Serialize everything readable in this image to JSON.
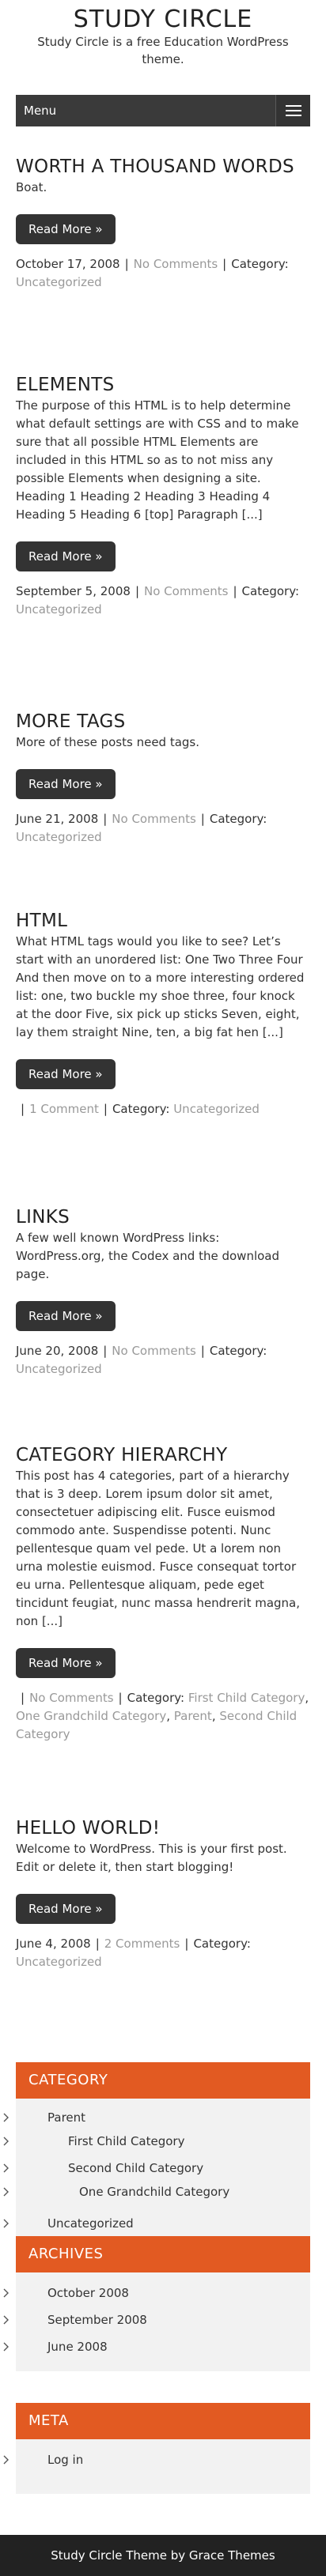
{
  "site": {
    "title": "STUDY CIRCLE",
    "description": "Study Circle is a free Education WordPress theme.",
    "menu_label": "Menu"
  },
  "posts": [
    {
      "title": "WORTH A THOUSAND WORDS",
      "excerpt": "Boat.",
      "read_more": "Read More »",
      "date": "October 17, 2008",
      "comments": "No Comments",
      "category_label": "Category:",
      "categories": [
        "Uncategorized"
      ]
    },
    {
      "title": "ELEMENTS",
      "excerpt": "The purpose of this HTML is to help determine what default settings are with CSS and to make sure that all possible HTML Elements are included in this HTML so as to not miss any possible Elements when designing a site. Heading 1 Heading 2 Heading 3 Heading 4 Heading 5 Heading 6 [top] Paragraph [...]",
      "read_more": "Read More »",
      "date": "September 5, 2008",
      "comments": "No Comments",
      "category_label": "Category:",
      "categories": [
        "Uncategorized"
      ]
    },
    {
      "title": "MORE TAGS",
      "excerpt": "More of these posts need tags.",
      "read_more": "Read More »",
      "date": "June 21, 2008",
      "comments": "No Comments",
      "category_label": "Category:",
      "categories": [
        "Uncategorized"
      ]
    },
    {
      "title": "HTML",
      "excerpt": "What HTML tags would you like to see? Let’s start with an unordered list: One Two Three Four And then move on to a more interesting ordered list: one, two buckle my shoe three, four knock at the door Five, six pick up sticks Seven, eight, lay them straight Nine, ten, a big fat hen [...]",
      "read_more": "Read More »",
      "date": "",
      "comments": "1 Comment",
      "category_label": "Category:",
      "categories": [
        "Uncategorized"
      ]
    },
    {
      "title": "LINKS",
      "excerpt": "A few well known WordPress links: WordPress.org, the Codex and the download page.",
      "read_more": "Read More »",
      "date": "June 20, 2008",
      "comments": "No Comments",
      "category_label": "Category:",
      "categories": [
        "Uncategorized"
      ]
    },
    {
      "title": "CATEGORY HIERARCHY",
      "excerpt": "This post has 4 categories, part of a hierarchy that is 3 deep. Lorem ipsum dolor sit amet, consectetuer adipiscing elit. Fusce euismod commodo ante. Suspendisse potenti. Nunc pellentesque quam vel pede. Ut a lorem non urna molestie euismod. Fusce consequat tortor eu urna. Pellentesque aliquam, pede eget tincidunt feugiat, nunc massa hendrerit magna, non [...]",
      "read_more": "Read More »",
      "date": "",
      "comments": "No Comments",
      "category_label": "Category:",
      "categories": [
        "First Child Category",
        "One Grandchild Category",
        "Parent",
        "Second Child Category"
      ]
    },
    {
      "title": "HELLO WORLD!",
      "excerpt": "Welcome to WordPress. This is your first post. Edit or delete it, then start blogging!",
      "read_more": "Read More »",
      "date": "June 4, 2008",
      "comments": "2 Comments",
      "category_label": "Category:",
      "categories": [
        "Uncategorized"
      ]
    }
  ],
  "widgets": {
    "category": {
      "title": "CATEGORY",
      "items": [
        "Parent",
        "First Child Category",
        "Second Child Category",
        "One Grandchild Category",
        "Uncategorized"
      ]
    },
    "archives": {
      "title": "ARCHIVES",
      "items": [
        "October 2008",
        "September 2008",
        "June 2008"
      ]
    },
    "meta": {
      "title": "META",
      "items": [
        "Log in"
      ]
    }
  },
  "footer": {
    "text": "Study Circle Theme by Grace Themes"
  },
  "colors": {
    "accent": "#e25a22",
    "dark": "#333333",
    "muted": "#999999",
    "widget_bg": "#f2f2f2",
    "footer_bg": "#222222"
  },
  "icons": {
    "menu": "hamburger-icon",
    "list_bullet": "chevron-right-icon"
  }
}
